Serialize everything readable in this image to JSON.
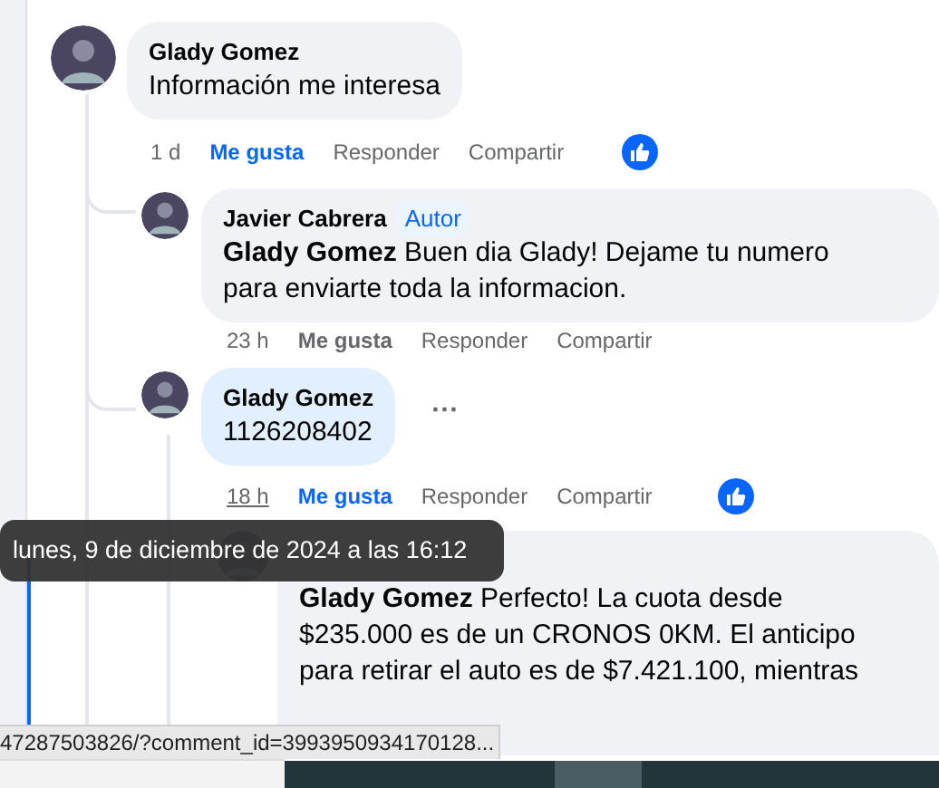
{
  "comments": [
    {
      "author": "Glady Gomez",
      "text": "Información me interesa",
      "highlighted": false,
      "time": "1 d",
      "time_hovered": false,
      "like_label": "Me gusta",
      "liked": true,
      "reply_label": "Responder",
      "share_label": "Compartir",
      "has_like_reaction": true
    },
    {
      "author": "Javier Cabrera",
      "author_badge": "Autor",
      "mention": "Glady Gomez",
      "text": "Buen dia Glady! Dejame tu numero para enviarte toda la informacion.",
      "highlighted": false,
      "time": "23 h",
      "time_hovered": false,
      "like_label": "Me gusta",
      "liked": false,
      "reply_label": "Responder",
      "share_label": "Compartir",
      "has_like_reaction": false
    },
    {
      "author": "Glady Gomez",
      "text": "1126208402",
      "highlighted": true,
      "more_menu": "···",
      "time": "18 h",
      "time_hovered": true,
      "like_label": "Me gusta",
      "liked": true,
      "reply_label": "Responder",
      "share_label": "Compartir",
      "has_like_reaction": true
    },
    {
      "mention": "Glady Gomez",
      "text": "Perfecto! La cuota desde $235.000 es de un CRONOS 0KM. El anticipo para retirar el auto es de $7.421.100, mientras",
      "highlighted": false
    }
  ],
  "tooltip": "lunes, 9 de diciembre de 2024 a las 16:12",
  "status_bar": "47287503826/?comment_id=3993950934170128..."
}
